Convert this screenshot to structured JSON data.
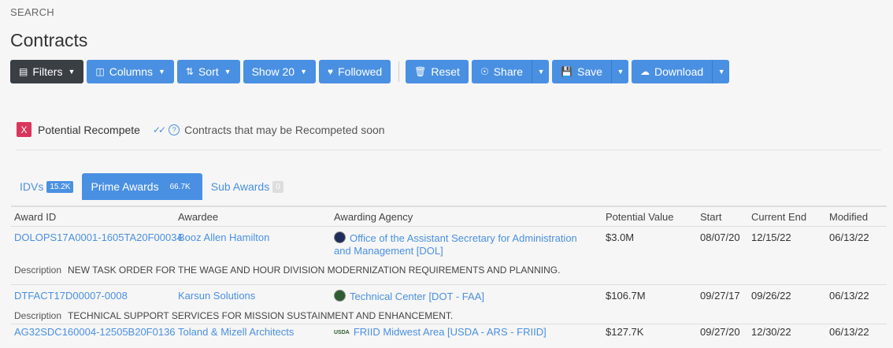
{
  "breadcrumb": "SEARCH",
  "title": "Contracts",
  "toolbar": {
    "filters": "Filters",
    "columns": "Columns",
    "sort": "Sort",
    "show": "Show 20",
    "followed": "Followed",
    "reset": "Reset",
    "share": "Share",
    "save": "Save",
    "download": "Download"
  },
  "recompete": {
    "badge": "X",
    "label": "Potential Recompete",
    "description": "Contracts that may be Recompeted soon"
  },
  "tabs": [
    {
      "label": "IDVs",
      "count": "15.2K"
    },
    {
      "label": "Prime Awards",
      "count": "66.7K"
    },
    {
      "label": "Sub Awards",
      "count": "0"
    }
  ],
  "columns": [
    "Award ID",
    "Awardee",
    "Awarding Agency",
    "Potential Value",
    "Start",
    "Current End",
    "Modified"
  ],
  "description_label": "Description",
  "rows": [
    {
      "award_id": "DOLOPS17A0001-1605TA20F00034",
      "awardee": "Booz Allen Hamilton",
      "agency_line1": "Office of the Assistant Secretary for Administration",
      "agency_line2": "and Management [DOL]",
      "value": "$3.0M",
      "start": "08/07/20",
      "end": "12/15/22",
      "modified": "06/13/22",
      "description": "NEW TASK ORDER FOR THE WAGE AND HOUR DIVISION MODERNIZATION REQUIREMENTS AND PLANNING."
    },
    {
      "award_id": "DTFACT17D00007-0008",
      "awardee": "Karsun Solutions",
      "agency_line1": "Technical Center [DOT - FAA]",
      "value": "$106.7M",
      "start": "09/27/17",
      "end": "09/26/22",
      "modified": "06/13/22",
      "description": "TECHNICAL SUPPORT SERVICES FOR MISSION SUSTAINMENT AND ENHANCEMENT."
    },
    {
      "award_id": "AG32SDC160004-12505B20F0136",
      "awardee": "Toland & Mizell Architects",
      "agency_logo": "USDA",
      "agency_line1": "FRIID Midwest Area [USDA - ARS - FRIID]",
      "value": "$127.7K",
      "start": "09/27/20",
      "end": "12/30/22",
      "modified": "06/13/22"
    }
  ]
}
